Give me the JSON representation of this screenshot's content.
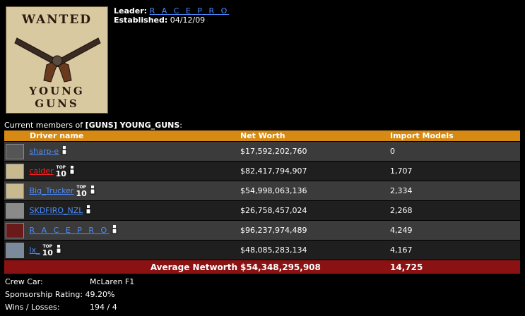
{
  "crest": {
    "top_word": "WANTED",
    "bottom_word_1": "YOUNG",
    "bottom_word_2": "GUNS"
  },
  "info": {
    "leader_label": "Leader:",
    "leader_value": "R A C E   P R O",
    "established_label": "Established:",
    "established_value": "04/12/09"
  },
  "members": {
    "caption_prefix": "Current members of ",
    "caption_crew": "[GUNS] YOUNG_GUNS",
    "caption_suffix": ":",
    "columns": {
      "driver": "Driver name",
      "networth": "Net Worth",
      "imports": "Import Models"
    },
    "rows": [
      {
        "name": "sharp-e",
        "networth": "$17,592,202,760",
        "imports": "0",
        "top10": false
      },
      {
        "name": "calder",
        "networth": "$82,417,794,907",
        "imports": "1,707",
        "top10": true
      },
      {
        "name": "Big_Trucker",
        "networth": "$54,998,063,136",
        "imports": "2,334",
        "top10": true
      },
      {
        "name": "SKDFIRO_NZL",
        "networth": "$26,758,457,024",
        "imports": "2,268",
        "top10": false
      },
      {
        "name": "R A C E   P R O",
        "networth": "$96,237,974,489",
        "imports": "4,249",
        "top10": false
      },
      {
        "name": "lx_",
        "networth": "$48,085,283,134",
        "imports": "4,167",
        "top10": true
      }
    ],
    "top10_top": "TOP",
    "top10_num": "10",
    "average_label": "Average Networth",
    "average_networth": "$54,348,295,908",
    "average_imports": "14,725"
  },
  "stats": {
    "car_label": "Crew Car:",
    "car_value": "McLaren F1",
    "sponsor_label": "Sponsorship Rating:",
    "sponsor_value": "49.20%",
    "wl_label": "Wins / Losses:",
    "wl_value": "194 / 4"
  }
}
